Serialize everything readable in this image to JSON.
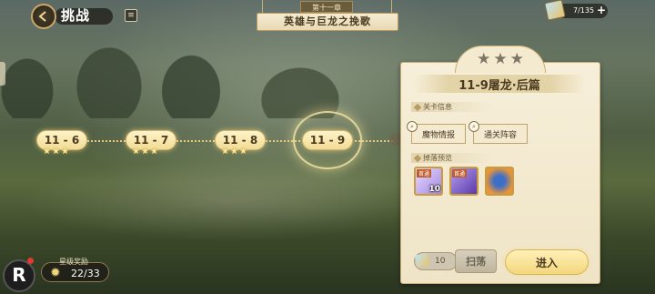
{
  "header": {
    "title": "挑战",
    "chapter_tag": "第十一章",
    "chapter_name": "英雄与巨龙之挽歌"
  },
  "currency": {
    "value": "7/135",
    "plus_label": "+"
  },
  "stages": [
    {
      "label": "11 - 6",
      "stars": 3
    },
    {
      "label": "11 - 7",
      "stars": 3
    },
    {
      "label": "11 - 8",
      "stars": 3
    },
    {
      "label": "11 - 9",
      "stars": 0,
      "current": true
    }
  ],
  "star_reward": {
    "label": "星级奖励",
    "count": "22/33"
  },
  "panel": {
    "stars_earned": 0,
    "stars_total": 3,
    "title": "11-9屠龙·后篇",
    "info_section": "关卡信息",
    "monster_info_label": "魔物情报",
    "clear_team_label": "通关阵容",
    "drops_section": "掉落预览",
    "drops": [
      {
        "name": "crystal",
        "badge": "首通",
        "count": "10",
        "color": "#b7a2e8"
      },
      {
        "name": "potion",
        "badge": "首通",
        "count": "",
        "color": "#7a5ac8"
      },
      {
        "name": "orb",
        "badge": "",
        "count": "",
        "color": "#e8943a"
      }
    ],
    "sweep_count": "10",
    "sweep_label": "扫荡",
    "enter_label": "进入"
  },
  "logo": {
    "letter": "R"
  }
}
